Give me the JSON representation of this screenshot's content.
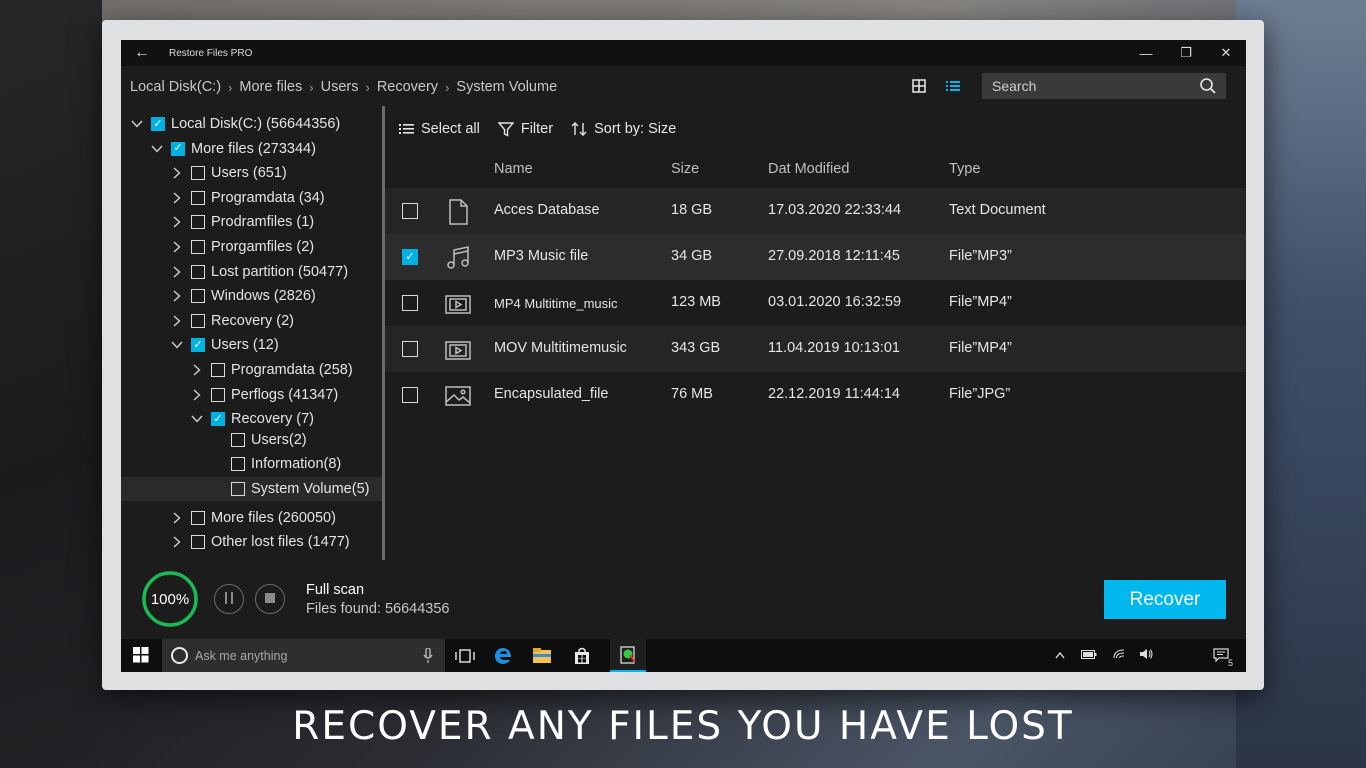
{
  "window": {
    "title": "Restore Files PRO",
    "back_label": "←",
    "minimize": "—",
    "maximize": "❐",
    "close": "✕"
  },
  "breadcrumb": [
    "Local Disk(C:)",
    "More files",
    "Users",
    "Recovery",
    "System Volume"
  ],
  "search": {
    "placeholder": "Search"
  },
  "tree": [
    {
      "label": "Local Disk(C:) (56644356)",
      "level": 0,
      "expanded": true,
      "checked": true
    },
    {
      "label": "More files (273344)",
      "level": 1,
      "expanded": true,
      "checked": true
    },
    {
      "label": "Users (651)",
      "level": 2,
      "expanded": false,
      "checked": false
    },
    {
      "label": "Programdata (34)",
      "level": 2,
      "expanded": false,
      "checked": false
    },
    {
      "label": "Prodramfiles (1)",
      "level": 2,
      "expanded": false,
      "checked": false
    },
    {
      "label": "Prorgamfiles (2)",
      "level": 2,
      "expanded": false,
      "checked": false
    },
    {
      "label": "Lost partition (50477)",
      "level": 2,
      "expanded": false,
      "checked": false
    },
    {
      "label": "Windows (2826)",
      "level": 2,
      "expanded": false,
      "checked": false
    },
    {
      "label": "Recovery (2)",
      "level": 2,
      "expanded": false,
      "checked": false
    },
    {
      "label": "Users (12)",
      "level": 2,
      "expanded": true,
      "checked": true
    },
    {
      "label": "Programdata (258)",
      "level": 3,
      "expanded": false,
      "checked": false
    },
    {
      "label": "Perflogs (41347)",
      "level": 3,
      "expanded": false,
      "checked": false
    },
    {
      "label": "Recovery (7)",
      "level": 3,
      "expanded": true,
      "checked": true
    },
    {
      "label": "Users(2)",
      "level": 4,
      "expanded": null,
      "checked": false
    },
    {
      "label": "Information(8)",
      "level": 4,
      "expanded": null,
      "checked": false
    },
    {
      "label": "System Volume(5)",
      "level": 4,
      "expanded": null,
      "checked": false,
      "selected": true
    },
    {
      "label": "More files (260050)",
      "level": 2,
      "expanded": false,
      "checked": false
    },
    {
      "label": "Other lost files (1477)",
      "level": 2,
      "expanded": false,
      "checked": false
    }
  ],
  "toolbar": {
    "select_all": "Select all",
    "filter": "Filter",
    "sort": "Sort by: Size"
  },
  "columns": {
    "name": "Name",
    "size": "Size",
    "date": "Dat Modified",
    "type": "Type"
  },
  "files": [
    {
      "name": "Acces Database",
      "size": "18 GB",
      "date": "17.03.2020 22:33:44",
      "type": "Text Document",
      "icon": "document-icon",
      "checked": false
    },
    {
      "name": "MP3 Music file",
      "size": "34 GB",
      "date": "27.09.2018 12:11:45",
      "type": "File”MP3”",
      "icon": "music-icon",
      "checked": true
    },
    {
      "name": "MP4 Multitime_music",
      "size": "123 MB",
      "date": "03.01.2020 16:32:59",
      "type": "File”MP4”",
      "icon": "video-icon",
      "checked": false
    },
    {
      "name": "MOV Multitimemusic",
      "size": "343 GB",
      "date": "11.04.2019 10:13:01",
      "type": "File”MP4”",
      "icon": "video-icon",
      "checked": false
    },
    {
      "name": "Encapsulated_file",
      "size": "76 MB",
      "date": "22.12.2019 11:44:14",
      "type": "File”JPG”",
      "icon": "image-icon",
      "checked": false
    }
  ],
  "status": {
    "progress_label": "100%",
    "progress_value": 1.0,
    "scan_title": "Full scan",
    "files_found": "Files found: 56644356",
    "recover_label": "Recover"
  },
  "taskbar": {
    "search_placeholder": "Ask me anything",
    "notification_count": "5"
  },
  "caption": "RECOVER ANY FILES YOU HAVE LOST",
  "colors": {
    "accent": "#00b8ee",
    "progress": "#1db954",
    "checkbox_checked": "#00b2e3"
  }
}
